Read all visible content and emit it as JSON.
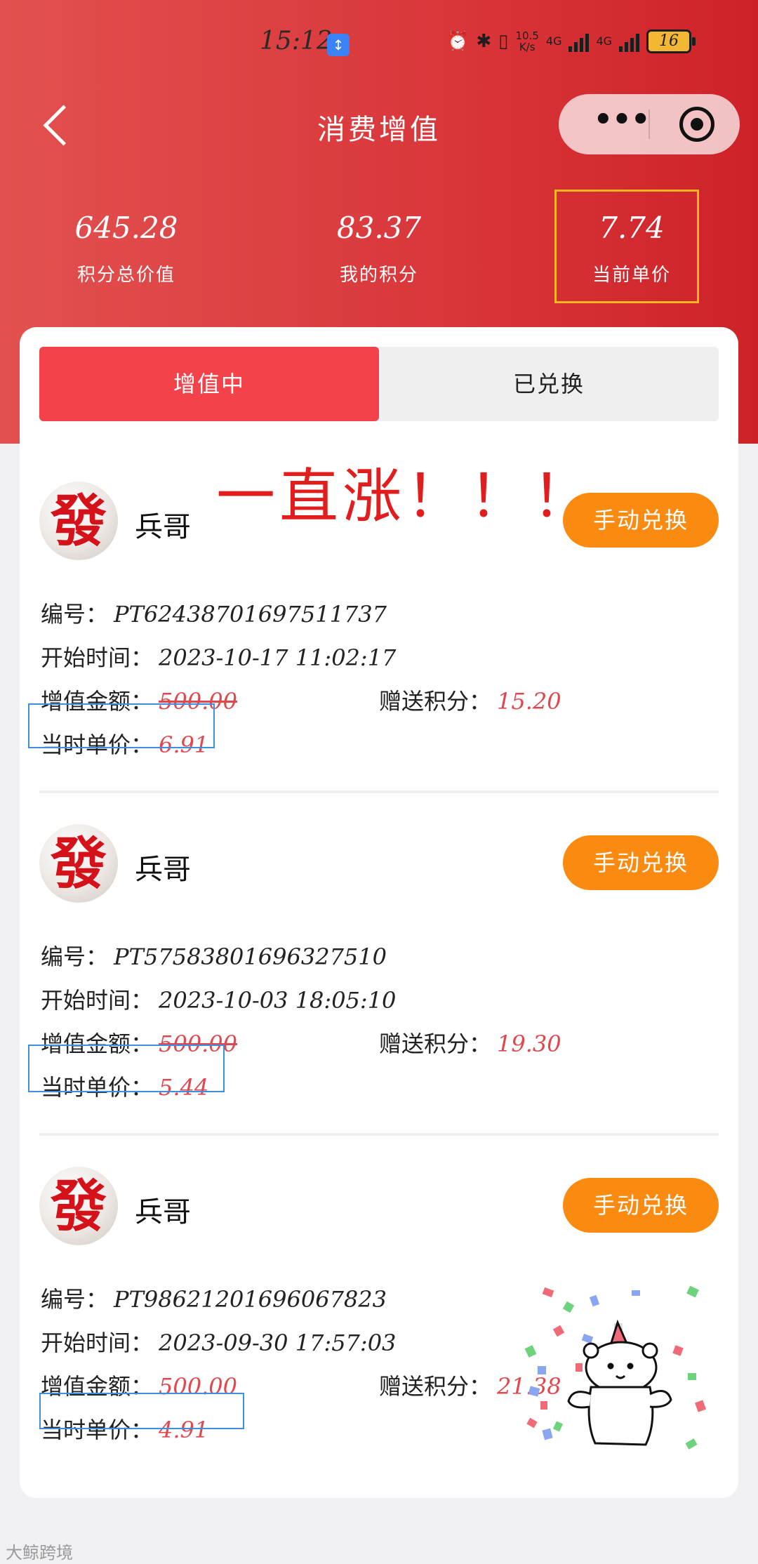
{
  "status_bar": {
    "time": "15:12",
    "sync_icon": "↕",
    "speed_value": "10.5",
    "speed_unit": "K/s",
    "network_1": "4G",
    "network_2": "4G",
    "battery": "16"
  },
  "nav": {
    "title": "消费增值"
  },
  "stats": [
    {
      "value": "645.28",
      "label": "积分总价值"
    },
    {
      "value": "83.37",
      "label": "我的积分"
    },
    {
      "value": "7.74",
      "label": "当前单价"
    }
  ],
  "tabs": {
    "active": "增值中",
    "inactive": "已兑换"
  },
  "annotation_text": "一直涨！！！",
  "labels": {
    "id": "编号：",
    "start_time": "开始时间：",
    "amount": "增值金额：",
    "bonus": "赠送积分：",
    "unit_price": "当时单价：",
    "redeem_button": "手动兑换"
  },
  "records": [
    {
      "avatar_char": "發",
      "name": "兵哥",
      "id": "PT62438701697511737",
      "start_time": "2023-10-17  11:02:17",
      "amount": "500.00",
      "bonus": "15.20",
      "unit_price": "6.91"
    },
    {
      "avatar_char": "發",
      "name": "兵哥",
      "id": "PT57583801696327510",
      "start_time": "2023-10-03  18:05:10",
      "amount": "500.00",
      "bonus": "19.30",
      "unit_price": "5.44"
    },
    {
      "avatar_char": "發",
      "name": "兵哥",
      "id": "PT98621201696067823",
      "start_time": "2023-09-30  17:57:03",
      "amount": "500.00",
      "bonus": "21.38",
      "unit_price": "4.91"
    }
  ],
  "watermark": "大鲸跨境",
  "colors": {
    "header_red": "#d9363a",
    "tab_active": "#f3424a",
    "button_orange": "#fb8a11",
    "value_red": "#e0484e",
    "highlight_yellow": "#f7b51f",
    "annotation_blue": "#3d8fe0"
  }
}
